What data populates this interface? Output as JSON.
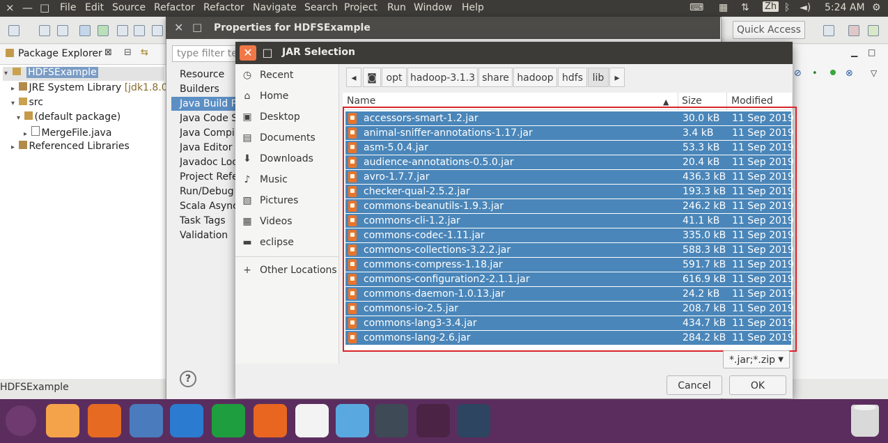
{
  "topbar": {
    "close_icon": "×",
    "minimize_icon": "—",
    "restore_icon": "□",
    "menus": [
      "File",
      "Edit",
      "Source",
      "Refactor",
      "Refactor",
      "Navigate",
      "Search",
      "Project",
      "Run",
      "Window",
      "Help"
    ],
    "input_method": "Zh",
    "time": "5:24 AM"
  },
  "eclipse": {
    "quick_access": "Quick Access",
    "package_explorer": {
      "tab_label": "Package Explorer",
      "tree": [
        {
          "label": "HDFSExample",
          "selected": true
        },
        {
          "label": "JRE System Library",
          "suffix": "[jdk1.8.0_"
        },
        {
          "label": "src"
        },
        {
          "label": "(default package)"
        },
        {
          "label": "MergeFile.java"
        },
        {
          "label": "Referenced Libraries"
        }
      ]
    },
    "status": "HDFSExample"
  },
  "properties_dialog": {
    "title": "Properties for HDFSExample",
    "filter_placeholder": "type filter te",
    "items": [
      {
        "label": "Resource",
        "expandable": true
      },
      {
        "label": "Builders",
        "expandable": false
      },
      {
        "label": "Java Build P",
        "expandable": false,
        "selected": true
      },
      {
        "label": "Java Code S",
        "expandable": true
      },
      {
        "label": "Java Compi",
        "expandable": true
      },
      {
        "label": "Java Editor",
        "expandable": true
      },
      {
        "label": "Javadoc Loc",
        "expandable": false
      },
      {
        "label": "Project Refe",
        "expandable": false
      },
      {
        "label": "Run/Debug",
        "expandable": false
      },
      {
        "label": "Scala Async",
        "expandable": false
      },
      {
        "label": "Task Tags",
        "expandable": false
      },
      {
        "label": "Validation",
        "expandable": true
      }
    ],
    "help": "?"
  },
  "jar_dialog": {
    "title": "JAR Selection",
    "places": [
      {
        "label": "Recent",
        "icon": "clock-icon"
      },
      {
        "label": "Home",
        "icon": "home-icon"
      },
      {
        "label": "Desktop",
        "icon": "desktop-icon"
      },
      {
        "label": "Documents",
        "icon": "documents-icon"
      },
      {
        "label": "Downloads",
        "icon": "downloads-icon"
      },
      {
        "label": "Music",
        "icon": "music-icon"
      },
      {
        "label": "Pictures",
        "icon": "pictures-icon"
      },
      {
        "label": "Videos",
        "icon": "videos-icon"
      },
      {
        "label": "eclipse",
        "icon": "folder-icon"
      },
      {
        "label": "Other Locations",
        "icon": "plus-icon"
      }
    ],
    "path": [
      "opt",
      "hadoop-3.1.3",
      "share",
      "hadoop",
      "hdfs",
      "lib"
    ],
    "columns": {
      "name": "Name",
      "size": "Size",
      "modified": "Modified"
    },
    "files": [
      {
        "name": "accessors-smart-1.2.jar",
        "size": "30.0 kB",
        "modified": "11 Sep 2019"
      },
      {
        "name": "animal-sniffer-annotations-1.17.jar",
        "size": "3.4 kB",
        "modified": "11 Sep 2019"
      },
      {
        "name": "asm-5.0.4.jar",
        "size": "53.3 kB",
        "modified": "11 Sep 2019"
      },
      {
        "name": "audience-annotations-0.5.0.jar",
        "size": "20.4 kB",
        "modified": "11 Sep 2019"
      },
      {
        "name": "avro-1.7.7.jar",
        "size": "436.3 kB",
        "modified": "11 Sep 2019"
      },
      {
        "name": "checker-qual-2.5.2.jar",
        "size": "193.3 kB",
        "modified": "11 Sep 2019"
      },
      {
        "name": "commons-beanutils-1.9.3.jar",
        "size": "246.2 kB",
        "modified": "11 Sep 2019"
      },
      {
        "name": "commons-cli-1.2.jar",
        "size": "41.1 kB",
        "modified": "11 Sep 2019"
      },
      {
        "name": "commons-codec-1.11.jar",
        "size": "335.0 kB",
        "modified": "11 Sep 2019"
      },
      {
        "name": "commons-collections-3.2.2.jar",
        "size": "588.3 kB",
        "modified": "11 Sep 2019"
      },
      {
        "name": "commons-compress-1.18.jar",
        "size": "591.7 kB",
        "modified": "11 Sep 2019"
      },
      {
        "name": "commons-configuration2-2.1.1.jar",
        "size": "616.9 kB",
        "modified": "11 Sep 2019"
      },
      {
        "name": "commons-daemon-1.0.13.jar",
        "size": "24.2 kB",
        "modified": "11 Sep 2019"
      },
      {
        "name": "commons-io-2.5.jar",
        "size": "208.7 kB",
        "modified": "11 Sep 2019"
      },
      {
        "name": "commons-lang3-3.4.jar",
        "size": "434.7 kB",
        "modified": "11 Sep 2019"
      },
      {
        "name": "commons-lang-2.6.jar",
        "size": "284.2 kB",
        "modified": "11 Sep 2019"
      }
    ],
    "filter": "*.jar;*.zip",
    "cancel": "Cancel",
    "ok": "OK",
    "highlight_color": "#d8232a",
    "selection_color": "#4a86b9"
  },
  "dock": {
    "apps": [
      {
        "icon": "ubuntu-icon",
        "color": "#6e3a6f"
      },
      {
        "icon": "files-icon",
        "color": "#f5a34a"
      },
      {
        "icon": "firefox-icon",
        "color": "#e66a22"
      },
      {
        "icon": "chromium-icon",
        "color": "#4a7bbd"
      },
      {
        "icon": "writer-icon",
        "color": "#2b7bd0"
      },
      {
        "icon": "calc-icon",
        "color": "#1e9e3e"
      },
      {
        "icon": "impress-icon",
        "color": "#e8661f"
      },
      {
        "icon": "input-method-icon",
        "color": "#f3f3f3"
      },
      {
        "icon": "software-icon",
        "color": "#5aa8e0"
      },
      {
        "icon": "vscode-icon",
        "color": "#3e4a55"
      },
      {
        "icon": "terminal-icon",
        "color": "#4b2344"
      },
      {
        "icon": "workspaces-icon",
        "color": "#2d4560"
      }
    ],
    "trash": "trash-icon"
  }
}
